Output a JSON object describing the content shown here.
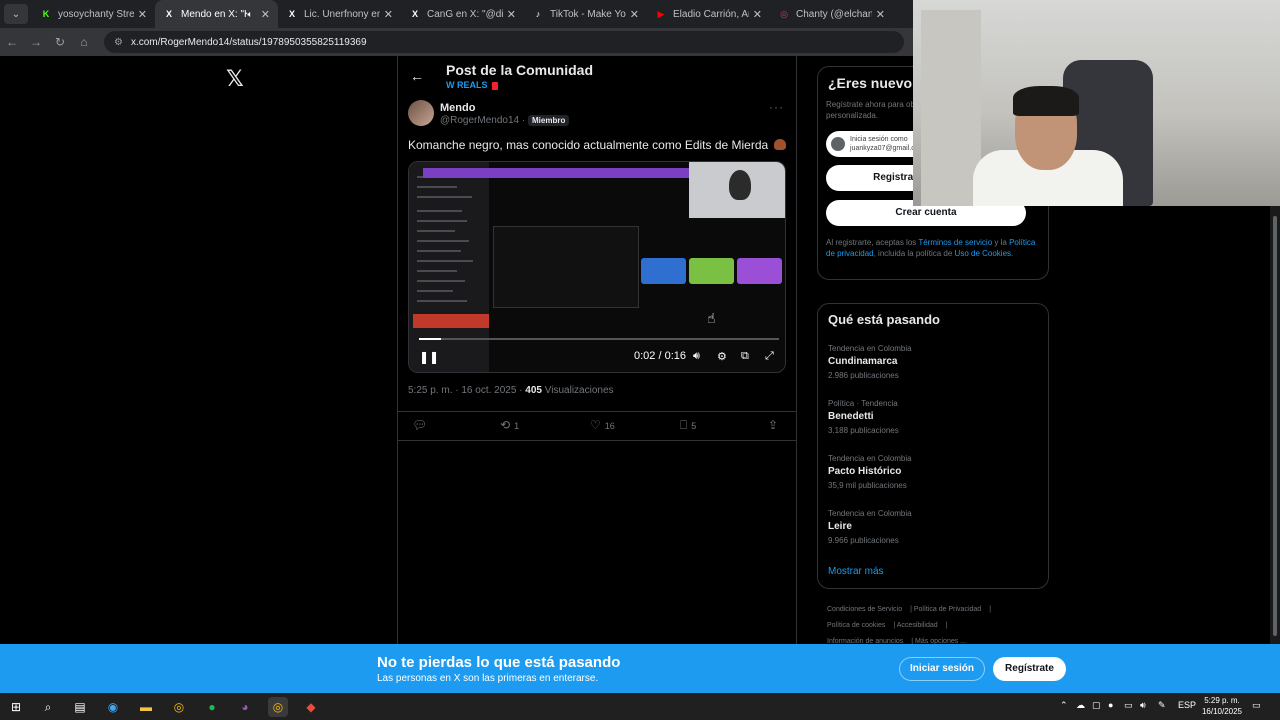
{
  "browser": {
    "tabs": [
      {
        "title": "yosoychanty Stream",
        "favicon": "K",
        "favcolor": "#53fc18",
        "active": false
      },
      {
        "title": "Mendo en X: \"Kom",
        "favicon": "X",
        "favcolor": "#ffffff",
        "active": true
      },
      {
        "title": "Lic. Unerfnony en X",
        "favicon": "X",
        "favcolor": "#ffffff",
        "active": false
      },
      {
        "title": "CanG en X: \"@diego",
        "favicon": "X",
        "favcolor": "#ffffff",
        "active": false
      },
      {
        "title": "TikTok - Make Your D",
        "favicon": "♪",
        "favcolor": "#ffffff",
        "active": false
      },
      {
        "title": "Eladio Carrión, Arcán",
        "favicon": "▶",
        "favcolor": "#ff0000",
        "active": false
      },
      {
        "title": "Chanty (@elchanty)",
        "favicon": "◎",
        "favcolor": "#e1306c",
        "active": false
      }
    ],
    "url": "x.com/RogerMendo14/status/1978950355825119369"
  },
  "header": {
    "title": "Post de la Comunidad",
    "community": "W REALS"
  },
  "post": {
    "author_name": "Mendo",
    "author_handle": "@RogerMendo14 ·",
    "badge": "Miembro",
    "text": "Komanche negro, mas conocido actualmente como Edits de Mierda",
    "video_time": "0:02 / 0:16",
    "timestamp": "5:25 p. m. · 16 oct. 2025 ·",
    "views_count": "405",
    "views_label": "Visualizaciones",
    "reposts": "1",
    "likes": "16",
    "bookmarks": "5",
    "video_progress": 0.06
  },
  "signup": {
    "title": "¿Eres nuevo en X?",
    "desc": "Regístrate ahora para obtener tu propia cronología personalizada.",
    "google_line1": "Inicia sesión como",
    "google_line2": "juankyza07@gmail.com",
    "apple_label": "Registrarse con Apple",
    "create_label": "Crear cuenta",
    "terms_pre": "Al registrarte, aceptas los",
    "terms_link": "Términos de servicio",
    "terms_mid": "y la",
    "privacy_link": "Política de privacidad",
    "terms_post": ", incluida la política de",
    "cookies_link": "Uso de Cookies."
  },
  "trends": {
    "title": "Qué está pasando",
    "items": [
      {
        "context": "Tendencia en Colombia",
        "name": "Cundinamarca",
        "count": "2.986 publicaciones"
      },
      {
        "context": "Política · Tendencia",
        "name": "Benedetti",
        "count": "3.188 publicaciones"
      },
      {
        "context": "Tendencia en Colombia",
        "name": "Pacto Histórico",
        "count": "35,9 mil publicaciones"
      },
      {
        "context": "Tendencia en Colombia",
        "name": "Leire",
        "count": "9.966 publicaciones"
      }
    ],
    "show_more": "Mostrar más"
  },
  "footer": {
    "links": [
      "Condiciones de Servicio",
      "Política de Privacidad",
      "Política de cookies",
      "Accesibilidad",
      "Información de anuncios",
      "Más opciones ..."
    ]
  },
  "banner": {
    "title": "No te pierdas lo que está pasando",
    "subtitle": "Las personas en X son las primeras en enterarse.",
    "login_label": "Iniciar sesión",
    "register_label": "Regístrate"
  },
  "taskbar": {
    "lang": "ESP",
    "time": "5:29 p. m.",
    "date": "16/10/2025"
  },
  "colors": {
    "accent": "#1d9bf0",
    "background": "#000000",
    "border": "#2f3336"
  }
}
